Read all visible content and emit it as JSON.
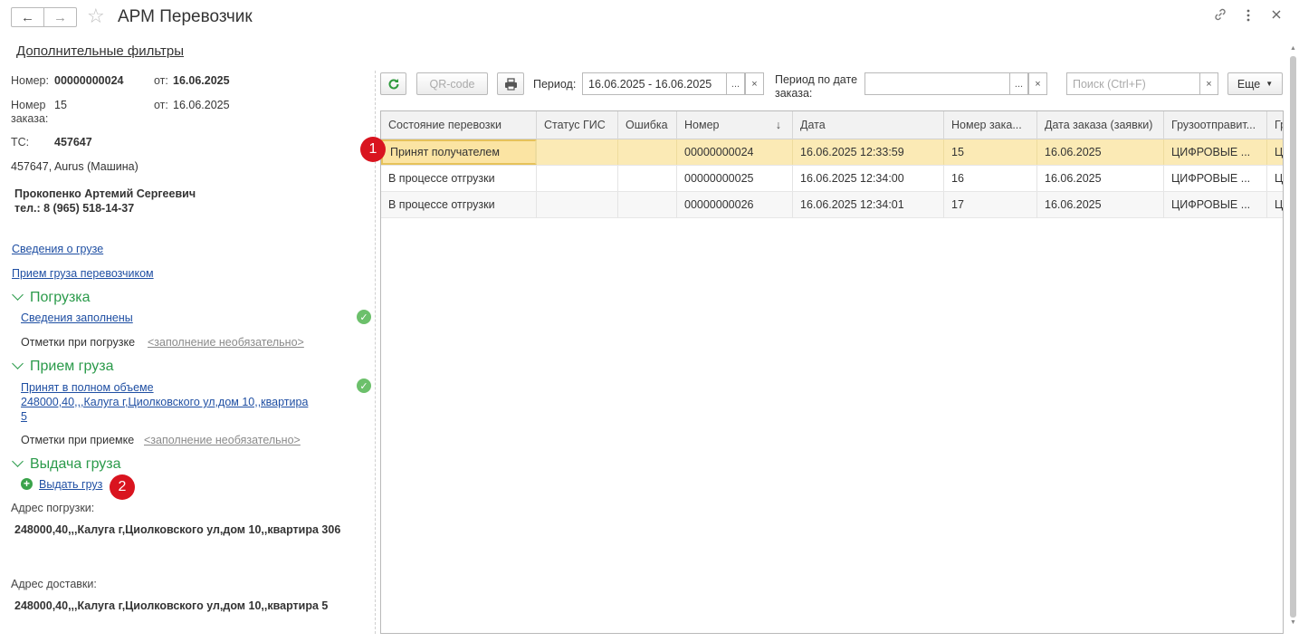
{
  "window": {
    "title": "АРМ Перевозчик",
    "back_icon": "←",
    "forward_icon": "→",
    "star_icon": "☆"
  },
  "filters_link": "Дополнительные фильтры",
  "left": {
    "number_label": "Номер:",
    "number_value": "00000000024",
    "from_label": "от:",
    "number_date": "16.06.2025",
    "order_label": "Номер заказа:",
    "order_value": "15",
    "order_from_label": "от:",
    "order_date": "16.06.2025",
    "ts_label": "ТС:",
    "ts_value": "457647",
    "vehicle": "457647, Aurus (Машина)",
    "driver_name": "Прокопенко Артемий Сергеевич",
    "driver_phone": "тел.: 8 (965) 518-14-37",
    "cargo_info_link": "Сведения о грузе",
    "cargo_accept_link": "Прием груза перевозчиком",
    "loading_section": "Погрузка",
    "loading_status_link": "Сведения заполнены",
    "loading_marks_label": "Отметки при погрузке",
    "loading_marks_link": "<заполнение необязательно>",
    "receive_section": "Прием груза",
    "receive_status_line1": "Принят в полном объеме",
    "receive_status_line2": "248000,40,,,Калуга г,Циолковского ул,дом 10,,квартира",
    "receive_status_line3": "5",
    "receive_marks_label": "Отметки при приемке",
    "receive_marks_link": "<заполнение необязательно>",
    "issue_section": "Выдача груза",
    "issue_link": "Выдать груз",
    "load_address_label": "Адрес погрузки:",
    "load_address": "248000,40,,,Калуга г,Циолковского ул,дом 10,,квартира 306",
    "delivery_address_label": "Адрес доставки:",
    "delivery_address": "248000,40,,,Калуга г,Циолковского ул,дом 10,,квартира 5"
  },
  "badges": {
    "one": "1",
    "two": "2"
  },
  "toolbar": {
    "qr_label": "QR-code",
    "period_label": "Период:",
    "period_value": "16.06.2025 - 16.06.2025",
    "period_by_order_label_1": "Период по дате",
    "period_by_order_label_2": "заказа:",
    "period_by_order_value": "",
    "search_placeholder": "Поиск (Ctrl+F)",
    "more_label": "Еще",
    "dots": "...",
    "clear": "×"
  },
  "table": {
    "columns": [
      "Состояние перевозки",
      "Статус ГИС",
      "Ошибка",
      "Номер",
      "Дата",
      "Номер зака...",
      "Дата заказа (заявки)",
      "Грузоотправит...",
      "Гр"
    ],
    "sort_icon": "↓",
    "rows": [
      [
        "Принят получателем",
        "",
        "",
        "00000000024",
        "16.06.2025 12:33:59",
        "15",
        "16.06.2025",
        "ЦИФРОВЫЕ ...",
        "Ц"
      ],
      [
        "В процессе отгрузки",
        "",
        "",
        "00000000025",
        "16.06.2025 12:34:00",
        "16",
        "16.06.2025",
        "ЦИФРОВЫЕ ...",
        "Ц"
      ],
      [
        "В процессе отгрузки",
        "",
        "",
        "00000000026",
        "16.06.2025 12:34:01",
        "17",
        "16.06.2025",
        "ЦИФРОВЫЕ ...",
        "Ц"
      ]
    ]
  }
}
